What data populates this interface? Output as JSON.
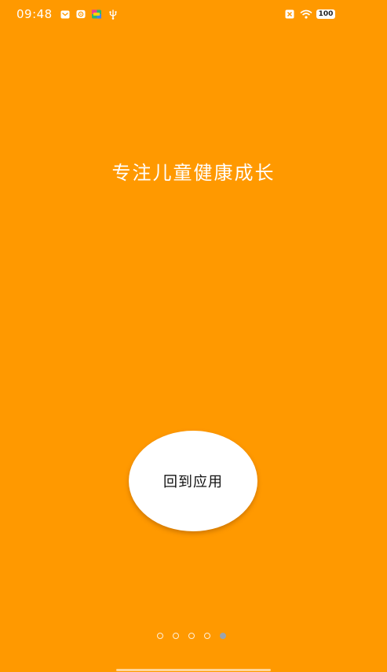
{
  "theme": {
    "background": "#FF9900",
    "text_color": "#FFFFFF",
    "button_color": "#FFFFFF",
    "dot_active": "#9AA4B0"
  },
  "status_bar": {
    "time": "09:48",
    "battery": "100",
    "icons_left": [
      "mail-icon",
      "notification-app-icon",
      "colorful-app-icon",
      "usb-icon"
    ],
    "icons_right": [
      "mute-icon",
      "wifi-icon",
      "battery-icon"
    ]
  },
  "main": {
    "headline": "专注儿童健康成长",
    "return_button": "回到应用"
  },
  "pager": {
    "count": 5,
    "active_index": 4
  }
}
